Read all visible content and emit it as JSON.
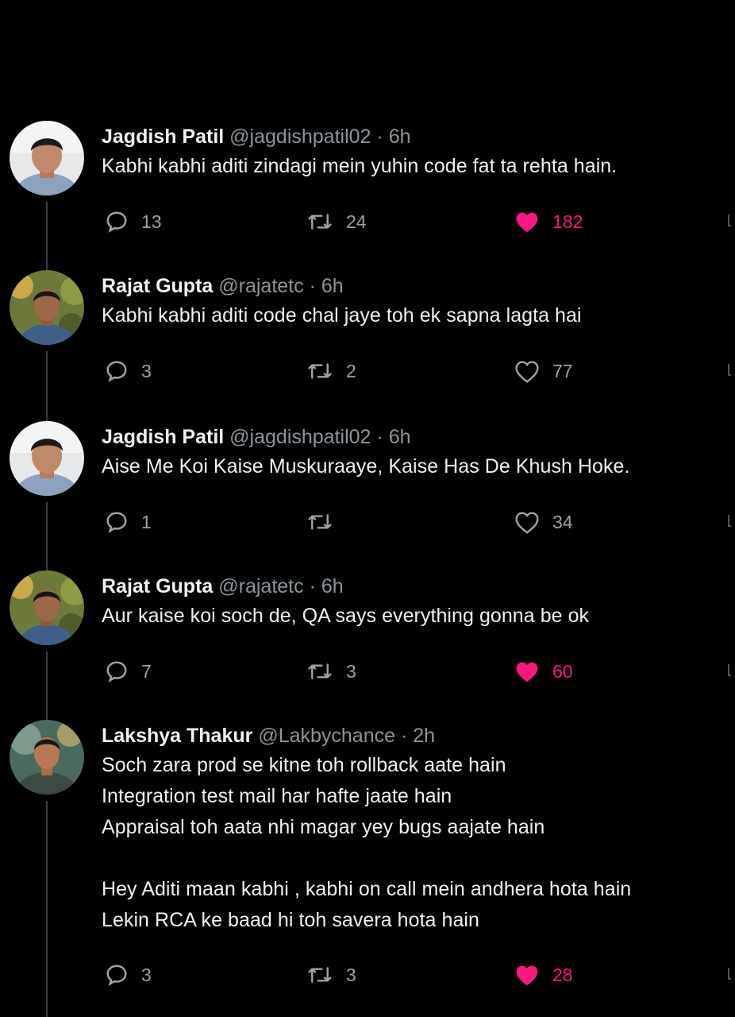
{
  "tweets": [
    {
      "name": "Jagdish Patil",
      "handle": "@jagdishpatil02",
      "sep": "·",
      "time": "6h",
      "text": "Kabhi kabhi aditi zindagi mein yuhin code fat ta rehta hain.",
      "replies": "13",
      "retweets": "24",
      "likes": "182",
      "liked": true,
      "avatar": "jagdish"
    },
    {
      "name": "Rajat Gupta",
      "handle": "@rajatetc",
      "sep": "·",
      "time": "6h",
      "text": "Kabhi kabhi aditi code chal jaye toh ek sapna lagta hai",
      "replies": "3",
      "retweets": "2",
      "likes": "77",
      "liked": false,
      "avatar": "rajat"
    },
    {
      "name": "Jagdish Patil",
      "handle": "@jagdishpatil02",
      "sep": "·",
      "time": "6h",
      "text": "Aise Me Koi Kaise Muskuraaye, Kaise Has De Khush Hoke.",
      "replies": "1",
      "retweets": "",
      "likes": "34",
      "liked": false,
      "avatar": "jagdish"
    },
    {
      "name": "Rajat Gupta",
      "handle": "@rajatetc",
      "sep": "·",
      "time": "6h",
      "text": "Aur kaise koi soch de, QA says everything gonna be ok",
      "replies": "7",
      "retweets": "3",
      "likes": "60",
      "liked": true,
      "avatar": "rajat"
    },
    {
      "name": "Lakshya Thakur",
      "handle": "@Lakbychance",
      "sep": "·",
      "time": "2h",
      "text": "Soch zara prod se kitne toh rollback aate hain\nIntegration test mail har hafte jaate hain\nAppraisal toh aata nhi magar yey bugs aajate hain\n\nHey Aditi maan kabhi , kabhi on call mein andhera hota hain\nLekin RCA ke baad hi toh savera hota hain",
      "replies": "3",
      "retweets": "3",
      "likes": "28",
      "liked": true,
      "avatar": "lakshya"
    }
  ],
  "colors": {
    "background": "#000000",
    "like_active": "#f91880",
    "muted": "#8b949b"
  },
  "icons": [
    "reply-icon",
    "retweet-icon",
    "heart-icon",
    "share-icon"
  ]
}
